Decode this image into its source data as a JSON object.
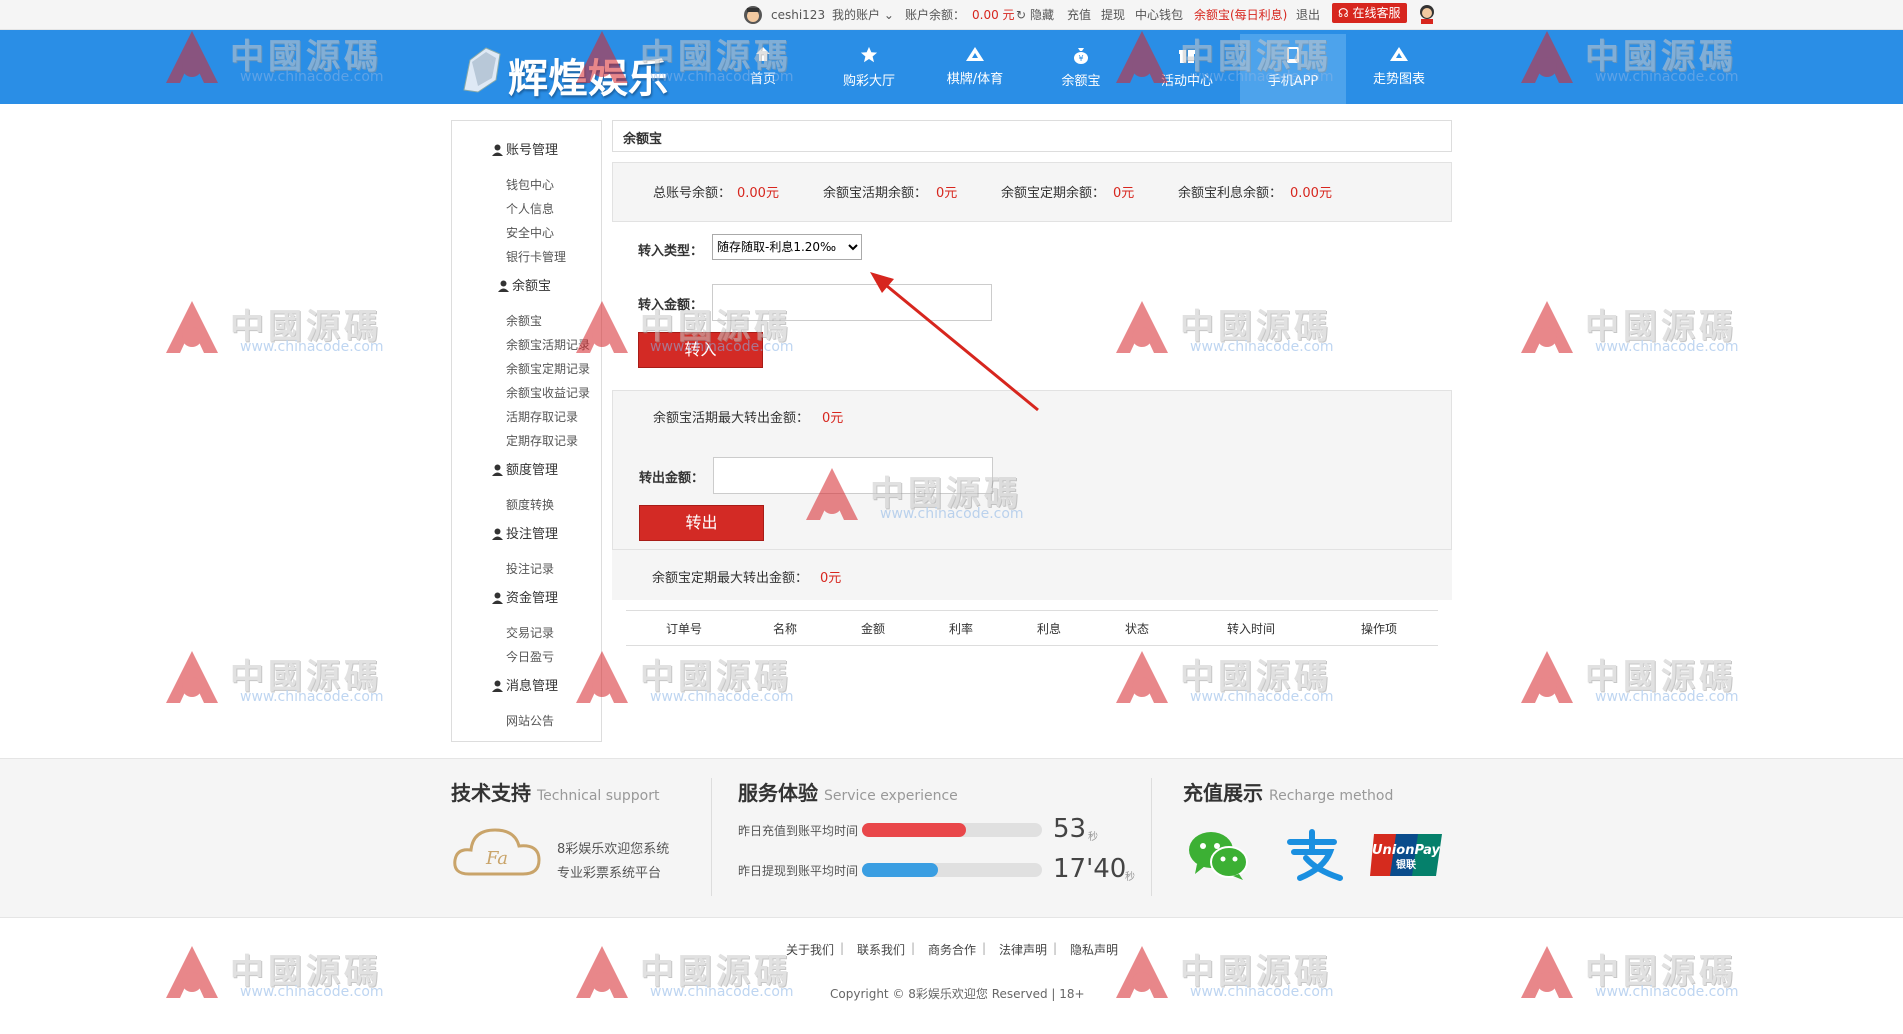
{
  "topbar": {
    "username": "ceshi123",
    "my_account": "我的账户",
    "balance_label": "账户余额：",
    "balance_value": "0.00 元",
    "hide": "隐藏",
    "recharge": "充值",
    "withdraw": "提现",
    "wallet": "中心钱包",
    "yuebao_promo": "余额宝(每日利息)",
    "logout": "退出",
    "service": "在线客服"
  },
  "brand": {
    "logo_text": "辉煌娱乐"
  },
  "nav": [
    {
      "label": "首页",
      "icon": "home-icon"
    },
    {
      "label": "购彩大厅",
      "icon": "star-icon"
    },
    {
      "label": "棋牌/体育",
      "icon": "triangle-icon"
    },
    {
      "label": "余额宝",
      "icon": "moneybag-icon"
    },
    {
      "label": "活动中心",
      "icon": "gift-icon"
    },
    {
      "label": "手机APP",
      "icon": "phone-icon"
    },
    {
      "label": "走势图表",
      "icon": "triangle-icon"
    }
  ],
  "sidebar": {
    "groups": [
      {
        "title": "账号管理",
        "items": [
          "钱包中心",
          "个人信息",
          "安全中心",
          "银行卡管理"
        ]
      },
      {
        "title": "余额宝",
        "items": [
          "余额宝",
          "余额宝活期记录",
          "余额宝定期记录",
          "余额宝收益记录",
          "活期存取记录",
          "定期存取记录"
        ]
      },
      {
        "title": "额度管理",
        "items": [
          "额度转换"
        ]
      },
      {
        "title": "投注管理",
        "items": [
          "投注记录"
        ]
      },
      {
        "title": "资金管理",
        "items": [
          "交易记录",
          "今日盈亏"
        ]
      },
      {
        "title": "消息管理",
        "items": [
          "网站公告"
        ]
      }
    ]
  },
  "main": {
    "title": "余额宝",
    "summary": {
      "total_label": "总账号余额：",
      "total_value": "0.00元",
      "current_label": "余额宝活期余额：",
      "current_value": "0元",
      "fixed_label": "余额宝定期余额：",
      "fixed_value": "0元",
      "interest_label": "余额宝利息余额：",
      "interest_value": "0.00元"
    },
    "transfer_in": {
      "type_label": "转入类型：",
      "type_selected": "随存随取-利息1.20‰",
      "amount_label": "转入金额：",
      "button": "转入"
    },
    "transfer_out": {
      "max_current_label": "余额宝活期最大转出金额：",
      "max_current_value": "0元",
      "amount_label": "转出金额：",
      "button": "转出",
      "max_fixed_label": "余额宝定期最大转出金额：",
      "max_fixed_value": "0元"
    },
    "table_headers": [
      "订单号",
      "名称",
      "金额",
      "利率",
      "利息",
      "状态",
      "转入时间",
      "操作项"
    ]
  },
  "footer": {
    "support": {
      "title": "技术支持",
      "subtitle": "Technical support",
      "logo_text": "Fa",
      "line1": "8彩娱乐欢迎您系统",
      "line2": "专业彩票系统平台"
    },
    "service": {
      "title": "服务体验",
      "subtitle": "Service experience",
      "deposit_label": "昨日充值到账平均时间",
      "deposit_value": "53",
      "deposit_unit": "秒",
      "deposit_fill": 0.58,
      "withdraw_label": "昨日提现到账平均时间",
      "withdraw_value": "17'40",
      "withdraw_unit": "秒",
      "withdraw_fill": 0.42
    },
    "recharge": {
      "title": "充值展示",
      "subtitle": "Recharge method",
      "unionpay_text": "UnionPay",
      "unionpay_cn": "银联"
    },
    "links": [
      "关于我们",
      "联系我们",
      "商务合作",
      "法律声明",
      "隐私声明"
    ],
    "copyright": "Copyright © 8彩娱乐欢迎您 Reserved | 18+"
  },
  "watermark": {
    "text": "中國源碼",
    "url": "www.chinacode.com"
  },
  "colors": {
    "nav_blue": "#2a8ee6",
    "red_button": "#d32a25",
    "red_text": "#d7261e"
  }
}
